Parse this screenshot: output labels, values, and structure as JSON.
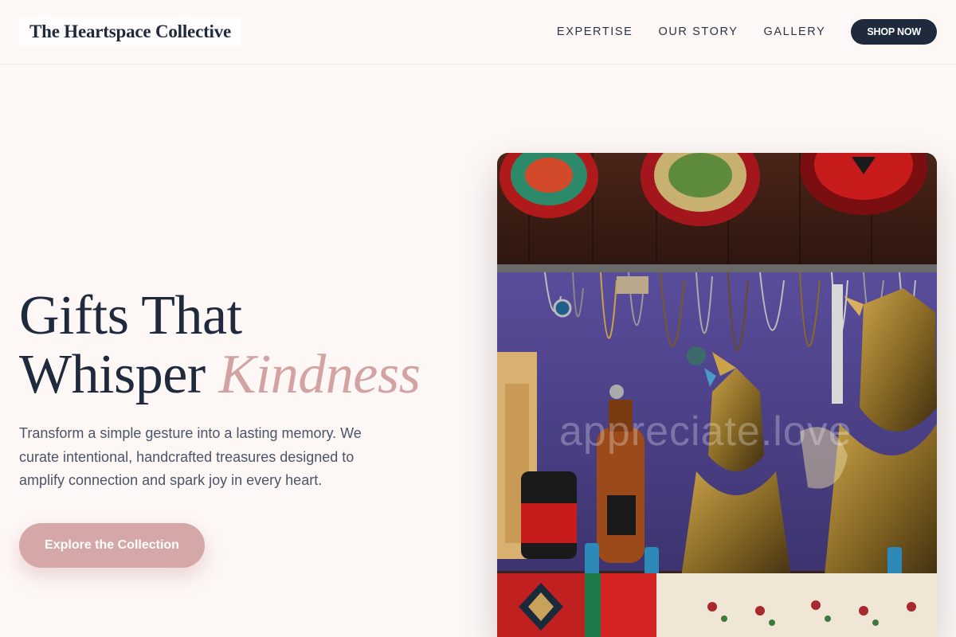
{
  "brand": {
    "name": "The Heartspace Collective"
  },
  "nav": {
    "links": [
      "EXPERTISE",
      "OUR STORY",
      "GALLERY"
    ],
    "cta_label": "SHOP NOW"
  },
  "hero": {
    "title_line1": "Gifts That",
    "title_line2": "Whisper",
    "title_accent": "Kindness",
    "description": "Transform a simple gesture into a lasting memory. We curate intentional, handcrafted treasures designed to amplify connection and spark joy in every heart.",
    "cta_label": "Explore the Collection",
    "image": {
      "subject": "souvenir shop display with decorative plates, hanging jewelry, bronze busts, bottles and embroidered textiles",
      "watermark": "appreciate.love"
    }
  },
  "colors": {
    "background": "#fdf7f6",
    "navy": "#1f2a3d",
    "rose": "#d5a7a7",
    "rose_text": "#d3a3a3",
    "body_text": "#4c5466"
  }
}
